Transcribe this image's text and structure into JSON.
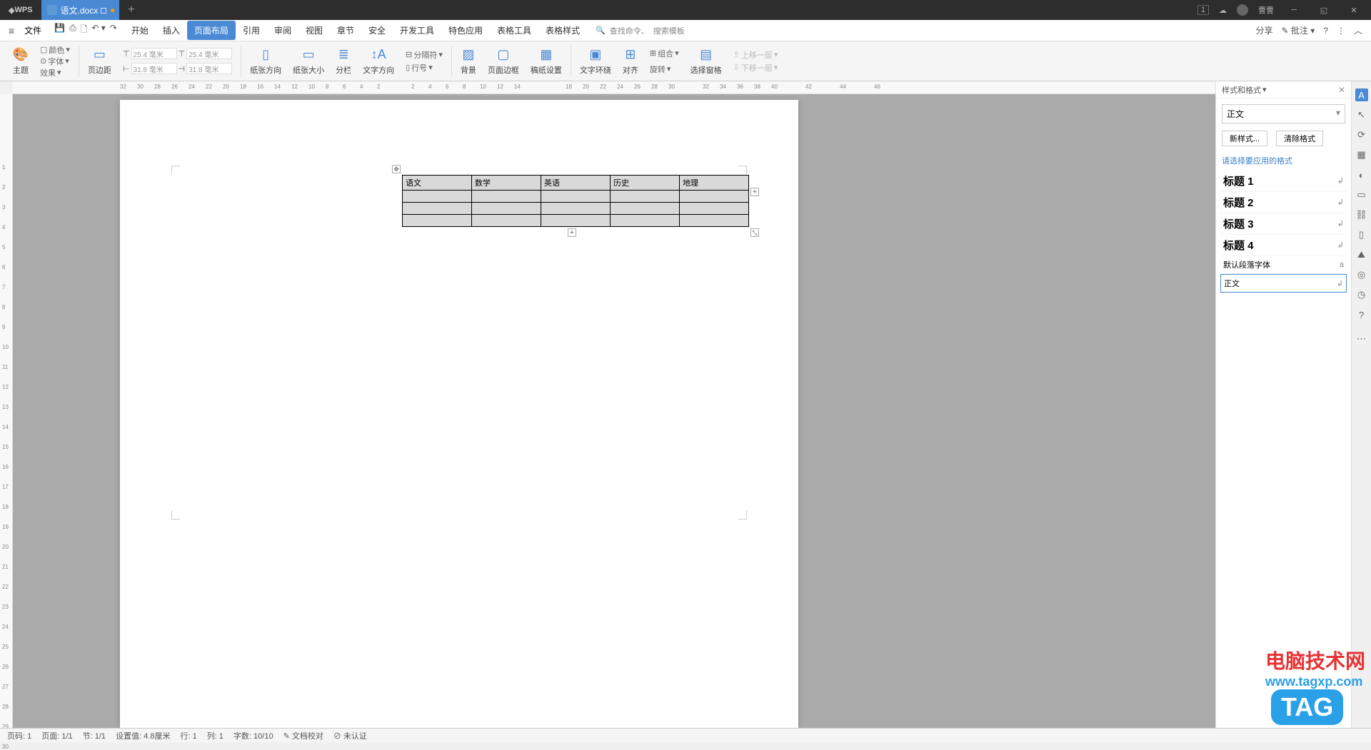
{
  "titlebar": {
    "app": "WPS",
    "doc_tab": "语文.docx",
    "user_name": "曹曹",
    "badge": "1"
  },
  "menubar": {
    "file": "文件",
    "tabs": [
      "开始",
      "插入",
      "页面布局",
      "引用",
      "审阅",
      "视图",
      "章节",
      "安全",
      "开发工具",
      "特色应用",
      "表格工具",
      "表格样式"
    ],
    "active_index": 2,
    "search_label": "查找命令、",
    "search_placeholder": "搜索模板",
    "share": "分享",
    "annotate": "批注"
  },
  "ribbon": {
    "theme": "主题",
    "color": "颜色",
    "font": "字体",
    "effect": "效果",
    "page_margin": "页边距",
    "margins": {
      "top": "25.4 毫米",
      "bottom": "25.4 毫米",
      "left": "31.8 毫米",
      "right": "31.8 毫米"
    },
    "orientation": "纸张方向",
    "size": "纸张大小",
    "columns": "分栏",
    "direction": "文字方向",
    "sep": "分隔符",
    "lineno": "行号",
    "bg": "背景",
    "border": "页面边框",
    "grid": "稿纸设置",
    "textwrap": "文字环绕",
    "align": "对齐",
    "combine": "组合",
    "rotate": "旋转",
    "pane": "选择窗格",
    "moveup": "上移一层",
    "movedown": "下移一层"
  },
  "doc_table": [
    "语文",
    "数学",
    "英语",
    "历史",
    "地理"
  ],
  "styles_panel": {
    "title": "样式和格式",
    "current": "正文",
    "new_btn": "新样式...",
    "clear_btn": "清除格式",
    "instruction": "请选择要应用的格式",
    "styles": [
      {
        "name": "标题 1",
        "ret": "↲",
        "big": true
      },
      {
        "name": "标题 2",
        "ret": "↲",
        "big": true
      },
      {
        "name": "标题 3",
        "ret": "↲",
        "big": true
      },
      {
        "name": "标题 4",
        "ret": "↲",
        "big": true
      },
      {
        "name": "默认段落字体",
        "ret": "a",
        "big": false
      },
      {
        "name": "正文",
        "ret": "↲",
        "big": false,
        "selected": true
      }
    ]
  },
  "statusbar": {
    "page_no": "页码: 1",
    "pages": "页面: 1/1",
    "section": "节: 1/1",
    "pos": "设置值: 4.8厘米",
    "line": "行: 1",
    "col": "列: 1",
    "words": "字数: 10/10",
    "proof": "文档校对",
    "auth": "未认证"
  },
  "watermark": {
    "line1": "电脑技术网",
    "line2": "www.tagxp.com",
    "tag": "TAG"
  }
}
